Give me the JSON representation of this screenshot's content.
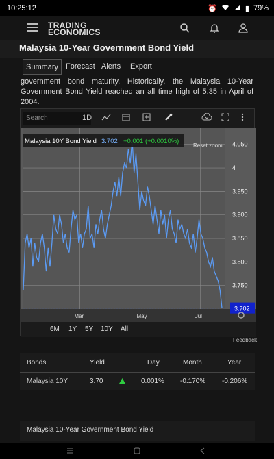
{
  "status": {
    "time": "10:25:12",
    "battery": "79%"
  },
  "app": {
    "logo_line1": "TRADING",
    "logo_line2": "ECONOMICS"
  },
  "page": {
    "title": "Malaysia 10-Year Government Bond Yield"
  },
  "tabs": [
    "Summary",
    "Forecast",
    "Alerts",
    "Export"
  ],
  "intro_text": "government bond maturity. Historically, the Malaysia 10-Year Government Bond Yield reached an all time high of 5.35 in April of 2004.",
  "chart_toolbar": {
    "search_placeholder": "Search",
    "interval": "1D"
  },
  "chart_data": {
    "type": "line",
    "series": [
      {
        "name": "Malaysia 10Y Bond Yield",
        "values": [
          3.74,
          3.84,
          3.86,
          3.83,
          3.85,
          3.79,
          3.84,
          3.81,
          3.8,
          3.84,
          3.86,
          3.83,
          3.78,
          3.83,
          3.79,
          3.84,
          3.9,
          3.87,
          3.86,
          3.9,
          3.88,
          3.84,
          3.86,
          3.83,
          3.82,
          3.87,
          3.91,
          3.89,
          3.9,
          3.84,
          3.86,
          3.83,
          3.86,
          3.87,
          3.92,
          3.85,
          3.86,
          3.83,
          3.88,
          3.86,
          3.89,
          3.91,
          3.87,
          3.85,
          3.88,
          3.9,
          3.92,
          3.95,
          3.97,
          3.94,
          3.98,
          3.94,
          3.99,
          4.01,
          4.0,
          4.04,
          4.01,
          4.06,
          3.99,
          4.03,
          3.97,
          3.91,
          3.95,
          3.93,
          3.92,
          3.96,
          3.94,
          3.91,
          3.88,
          3.92,
          3.89,
          3.86,
          3.91,
          3.88,
          3.9,
          3.85,
          3.89,
          3.91,
          3.87,
          3.86,
          3.84,
          3.89,
          3.87,
          3.88,
          3.86,
          3.85,
          3.87,
          3.84,
          3.83,
          3.86,
          3.82,
          3.85,
          3.89,
          3.86,
          3.85,
          3.83,
          3.82,
          3.8,
          3.79,
          3.81,
          3.78,
          3.77,
          3.76,
          3.74,
          3.702
        ]
      }
    ],
    "x_labels": [
      "Mar",
      "May",
      "Jul"
    ],
    "ylim": [
      3.7,
      4.07
    ],
    "y_ticks": [
      "4.050",
      "4",
      "3.950",
      "3.900",
      "3.850",
      "3.800",
      "3.750"
    ],
    "last_value": "3.702",
    "info": {
      "name": "Malaysia 10Y Bond Yield",
      "value": "3.702",
      "change": "+0.001",
      "change_pct": "(+0.0010%)"
    },
    "reset_zoom": "Reset zoom"
  },
  "ranges": [
    "6M",
    "1Y",
    "5Y",
    "10Y",
    "All"
  ],
  "feedback": "Feedback",
  "table": {
    "headers": [
      "Bonds",
      "Yield",
      "Day",
      "Month",
      "Year"
    ],
    "rows": [
      {
        "bond": "Malaysia 10Y",
        "yield": "3.70",
        "day": "0.001%",
        "month": "-0.170%",
        "year": "-0.206%"
      }
    ]
  },
  "related_title": "Malaysia 10-Year Government Bond Yield",
  "colors": {
    "line": "#5b9bf5",
    "up": "#2ecc40",
    "value_badge": "#1122cc"
  }
}
